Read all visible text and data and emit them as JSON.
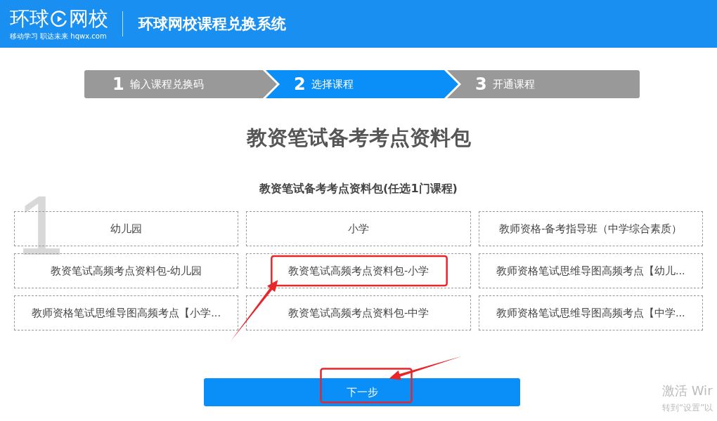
{
  "header": {
    "logo": {
      "left": "环球",
      "right": "网校",
      "tagline": "移动学习 职达未来 hqwx.com"
    },
    "title": "环球网校课程兑换系统"
  },
  "steps": [
    {
      "number": "1",
      "label": "输入课程兑换码",
      "selected": false
    },
    {
      "number": "2",
      "label": "选择课程",
      "selected": true
    },
    {
      "number": "3",
      "label": "开通课程",
      "selected": false
    }
  ],
  "page_title": "教资笔试备考考点资料包",
  "group": {
    "number": "1",
    "title": "教资笔试备考考点资料包(任选1门课程)",
    "courses": [
      {
        "label": "幼儿园",
        "annotated": false
      },
      {
        "label": "小学",
        "annotated": false
      },
      {
        "label": "教师资格-备考指导班（中学综合素质）",
        "annotated": false
      },
      {
        "label": "教资笔试高频考点资料包-幼儿园",
        "annotated": false
      },
      {
        "label": "教资笔试高频考点资料包-小学",
        "annotated": true
      },
      {
        "label": "教师资格笔试思维导图高频考点【幼儿...",
        "annotated": false
      },
      {
        "label": "教师资格笔试思维导图高频考点【小学...",
        "annotated": false
      },
      {
        "label": "教资笔试高频考点资料包-中学",
        "annotated": false
      },
      {
        "label": "教师资格笔试思维导图高频考点【中学...",
        "annotated": false
      }
    ]
  },
  "next_button": {
    "label": "下一步",
    "annotated": true
  },
  "os_notice": {
    "title": "激活 Wir",
    "text": "转到“设置”以"
  }
}
